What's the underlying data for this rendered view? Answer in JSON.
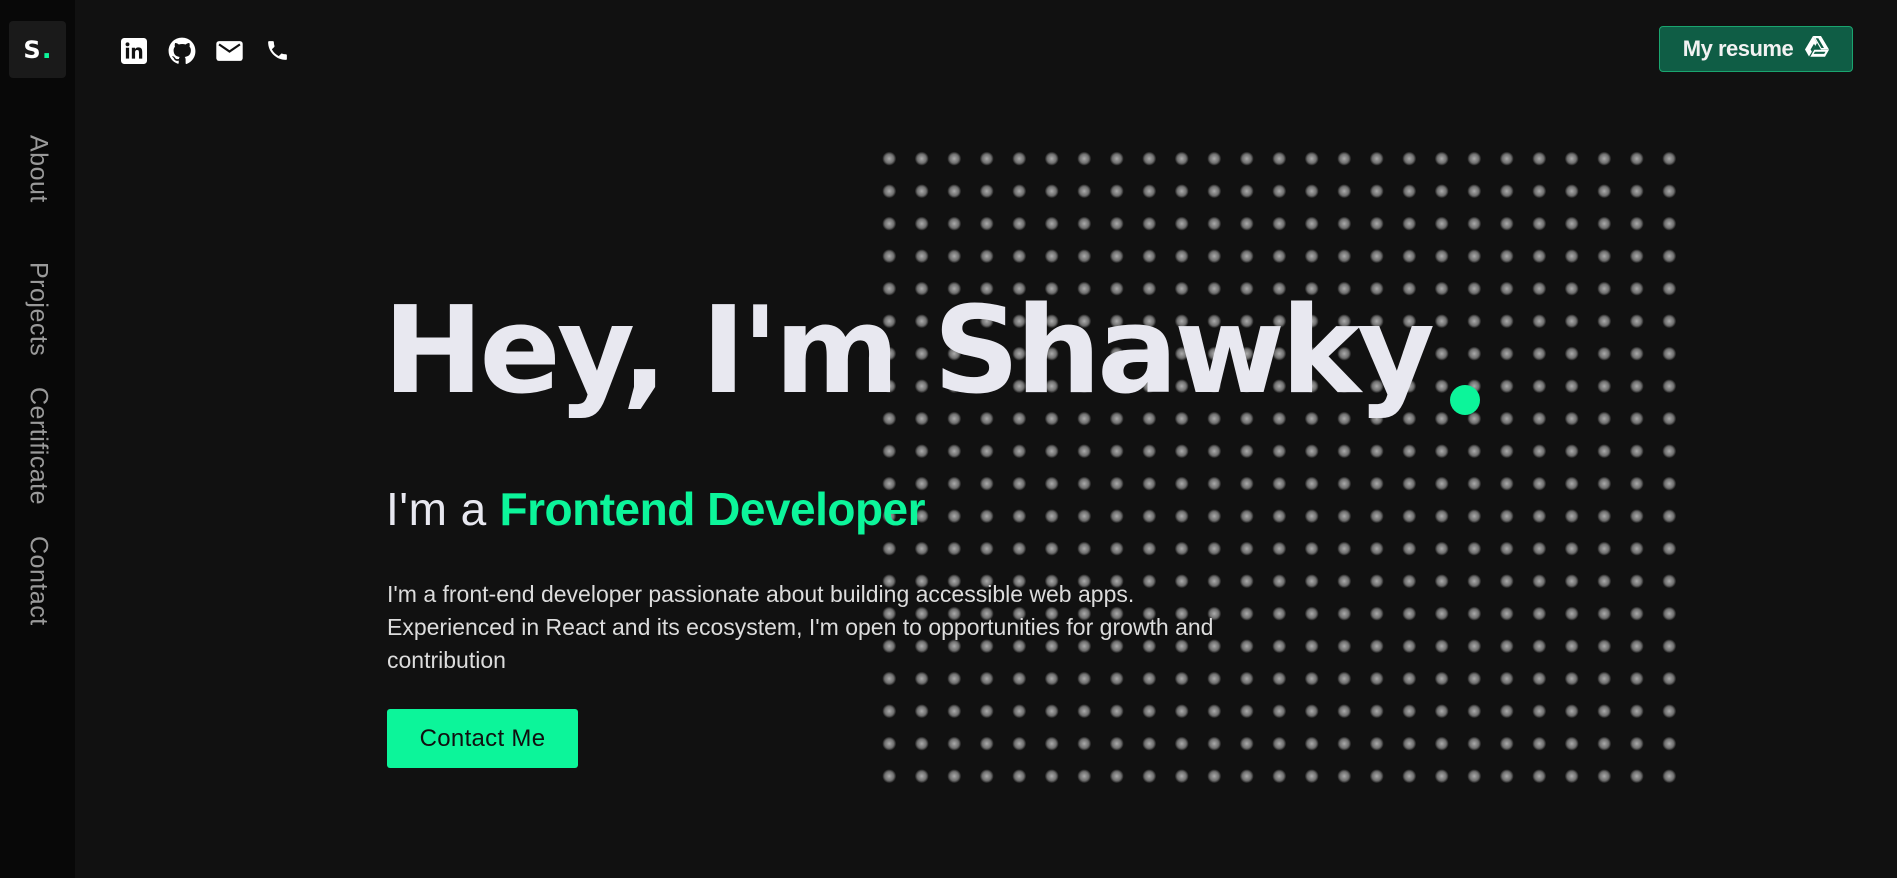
{
  "brand": {
    "logo_letter": "S",
    "logo_dot": "."
  },
  "nav": [
    {
      "label": "About"
    },
    {
      "label": "Projects"
    },
    {
      "label": "Certificate"
    },
    {
      "label": "Contact"
    }
  ],
  "social_icons": [
    "linkedin-icon",
    "github-icon",
    "mail-icon",
    "phone-icon"
  ],
  "resume_button": {
    "label": "My resume",
    "icon": "google-drive-icon"
  },
  "hero": {
    "title": "Hey, I'm Shawky",
    "subtitle_prefix": "I'm a",
    "role": "Frontend Developer",
    "description": "I'm a front-end developer passionate about building accessible web apps. Experienced in React and its ecosystem, I'm open to opportunities for growth and contribution",
    "cta_label": "Contact Me"
  },
  "colors": {
    "accent": "#0cf59a",
    "background": "#111111",
    "sidebar": "#080808",
    "resume_button": "#0f5d45"
  }
}
